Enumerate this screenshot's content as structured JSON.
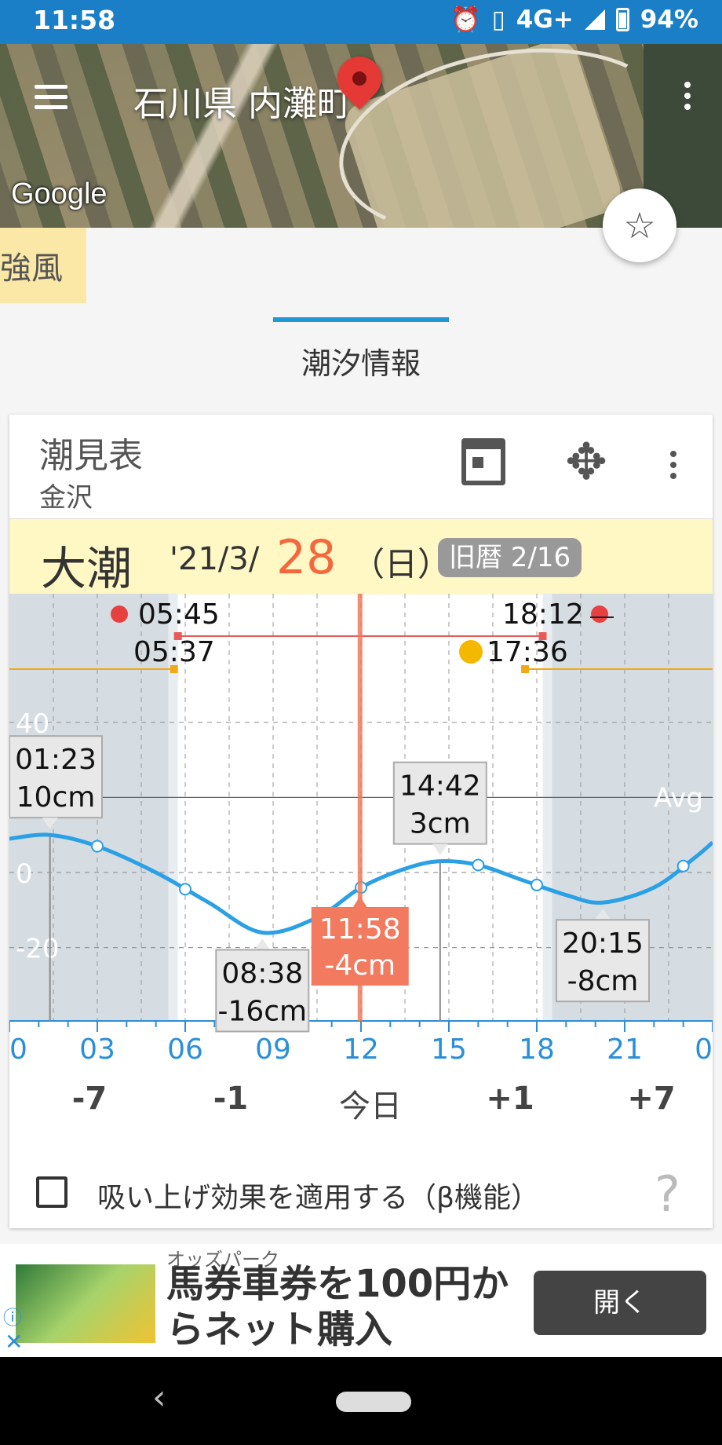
{
  "status_bar": {
    "time": "11:58",
    "network": "4G+",
    "battery": "94%"
  },
  "map": {
    "title": "石川県 内灘町",
    "attribution": "Google"
  },
  "wind_badge": "強風",
  "tab": {
    "label": "潮汐情報"
  },
  "card": {
    "title": "潮見表",
    "location": "金沢",
    "band": {
      "tide_type": "大潮",
      "date_prefix": "'21/3/",
      "day": "28",
      "weekday": "（日）",
      "lunar": "旧暦 2/16"
    },
    "nav": [
      "-7",
      "-1",
      "今日",
      "+1",
      "+7"
    ],
    "checkbox_label": "吸い上げ効果を適用する（β機能）",
    "help_glyph": "?"
  },
  "chart_data": {
    "type": "line",
    "x_ticks": [
      "0",
      "03",
      "06",
      "09",
      "12",
      "15",
      "18",
      "21",
      "0"
    ],
    "y_ticks": [
      "40",
      "0",
      "-20"
    ],
    "avg_label": "Avg",
    "xlim": [
      0,
      24
    ],
    "ylim": [
      -25,
      55
    ],
    "sunrise": "05:45",
    "sunset": "18:12",
    "moonrise": "05:37",
    "moonset": "17:36",
    "avg_level": 20,
    "current": {
      "time": "11:58",
      "level": "-4cm"
    },
    "extremes": [
      {
        "time": "01:23",
        "level": "10cm",
        "type": "high"
      },
      {
        "time": "08:38",
        "level": "-16cm",
        "type": "low"
      },
      {
        "time": "14:42",
        "level": "3cm",
        "type": "high"
      },
      {
        "time": "20:15",
        "level": "-8cm",
        "type": "low"
      }
    ],
    "series": [
      {
        "x": [
          0,
          1.38,
          3,
          5,
          6.8,
          8.63,
          10.5,
          12,
          13.5,
          14.7,
          16,
          17.5,
          19,
          20.25,
          22,
          23.4,
          24
        ],
        "y": [
          9,
          10,
          7,
          0,
          -8,
          -16,
          -12,
          -4,
          1,
          3,
          2,
          -2,
          -6,
          -8,
          -4,
          4,
          8
        ]
      }
    ],
    "markers_x": [
      3,
      6,
      12,
      16,
      18,
      23
    ]
  },
  "ad": {
    "advertiser": "オッズパーク",
    "headline": "馬券車券を100円からネット購入",
    "cta": "開く",
    "info_glyph": "ⓘ",
    "close_glyph": "✕"
  }
}
